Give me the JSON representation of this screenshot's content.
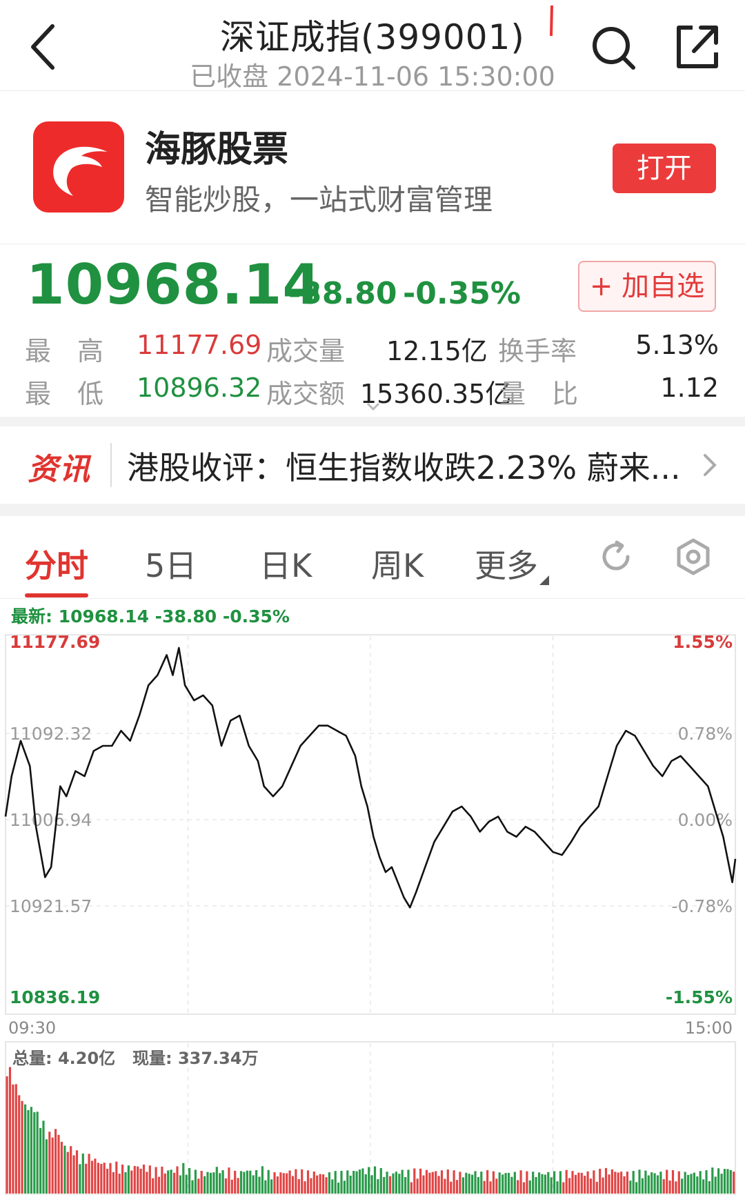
{
  "header": {
    "title": "深证成指(399001)",
    "subtitle": "已收盘 2024-11-06 15:30:00"
  },
  "promo": {
    "app_name": "海豚股票",
    "slogan": "智能炒股，一站式财富管理",
    "open_label": "打开"
  },
  "quote": {
    "last": "10968.14",
    "change": "-38.80",
    "change_pct": "-0.35%",
    "watch_label": "+ 加自选",
    "high_label": "最　高",
    "high": "11177.69",
    "low_label": "最　低",
    "low": "10896.32",
    "volume_label": "成交量",
    "volume": "12.15亿",
    "amount_label": "成交额",
    "amount": "15360.35亿",
    "turnover_label": "换手率",
    "turnover": "5.13%",
    "volume_ratio_label": "量　比",
    "volume_ratio": "1.12"
  },
  "news": {
    "tag": "资讯",
    "headline": "港股收评：恒生指数收跌2.23% 蔚来..."
  },
  "tabs": [
    {
      "label": "分时",
      "active": true
    },
    {
      "label": "5日",
      "active": false
    },
    {
      "label": "日K",
      "active": false
    },
    {
      "label": "周K",
      "active": false
    },
    {
      "label": "更多",
      "active": false
    }
  ],
  "chart_info": "最新: 10968.14  -38.80  -0.35%",
  "chart_data": {
    "type": "line",
    "y_labels_left": [
      "11177.69",
      "11092.32",
      "11006.94",
      "10921.57",
      "10836.19"
    ],
    "y_labels_right": [
      "1.55%",
      "0.78%",
      "0.00%",
      "-0.78%",
      "-1.55%"
    ],
    "x_labels": [
      "09:30",
      "15:00"
    ],
    "ylim": [
      10836.19,
      11177.69
    ],
    "prev_close": 11006.94,
    "x_range": [
      0,
      240
    ],
    "points": [
      [
        0,
        11010
      ],
      [
        2,
        11050
      ],
      [
        5,
        11085
      ],
      [
        8,
        11060
      ],
      [
        10,
        11000
      ],
      [
        13,
        10950
      ],
      [
        15,
        10960
      ],
      [
        18,
        11040
      ],
      [
        20,
        11030
      ],
      [
        23,
        11055
      ],
      [
        26,
        11050
      ],
      [
        29,
        11075
      ],
      [
        32,
        11080
      ],
      [
        35,
        11080
      ],
      [
        38,
        11095
      ],
      [
        41,
        11085
      ],
      [
        44,
        11110
      ],
      [
        47,
        11140
      ],
      [
        50,
        11150
      ],
      [
        53,
        11170
      ],
      [
        55,
        11150
      ],
      [
        57,
        11177
      ],
      [
        59,
        11140
      ],
      [
        62,
        11125
      ],
      [
        65,
        11130
      ],
      [
        68,
        11120
      ],
      [
        71,
        11080
      ],
      [
        74,
        11105
      ],
      [
        77,
        11110
      ],
      [
        80,
        11080
      ],
      [
        83,
        11065
      ],
      [
        85,
        11040
      ],
      [
        88,
        11030
      ],
      [
        91,
        11040
      ],
      [
        94,
        11060
      ],
      [
        97,
        11080
      ],
      [
        100,
        11090
      ],
      [
        103,
        11100
      ],
      [
        106,
        11100
      ],
      [
        109,
        11095
      ],
      [
        112,
        11090
      ],
      [
        115,
        11070
      ],
      [
        117,
        11040
      ],
      [
        119,
        11020
      ],
      [
        121,
        10990
      ],
      [
        123,
        10970
      ],
      [
        125,
        10955
      ],
      [
        127,
        10960
      ],
      [
        129,
        10945
      ],
      [
        131,
        10930
      ],
      [
        133,
        10920
      ],
      [
        135,
        10935
      ],
      [
        138,
        10960
      ],
      [
        141,
        10985
      ],
      [
        144,
        11000
      ],
      [
        147,
        11015
      ],
      [
        150,
        11020
      ],
      [
        153,
        11010
      ],
      [
        156,
        10995
      ],
      [
        159,
        11005
      ],
      [
        162,
        11010
      ],
      [
        165,
        10995
      ],
      [
        168,
        10990
      ],
      [
        171,
        11000
      ],
      [
        174,
        10995
      ],
      [
        177,
        10985
      ],
      [
        180,
        10975
      ],
      [
        183,
        10972
      ],
      [
        186,
        10985
      ],
      [
        189,
        11000
      ],
      [
        192,
        11010
      ],
      [
        195,
        11020
      ],
      [
        198,
        11050
      ],
      [
        201,
        11080
      ],
      [
        204,
        11095
      ],
      [
        207,
        11090
      ],
      [
        210,
        11075
      ],
      [
        213,
        11060
      ],
      [
        216,
        11050
      ],
      [
        219,
        11065
      ],
      [
        222,
        11070
      ],
      [
        225,
        11060
      ],
      [
        228,
        11050
      ],
      [
        231,
        11040
      ],
      [
        234,
        11010
      ],
      [
        236,
        10990
      ],
      [
        238,
        10960
      ],
      [
        239,
        10945
      ],
      [
        240,
        10968.14
      ]
    ]
  },
  "volume": {
    "total_label": "总量: 4.20亿",
    "current_label": "现量: 337.34万"
  }
}
